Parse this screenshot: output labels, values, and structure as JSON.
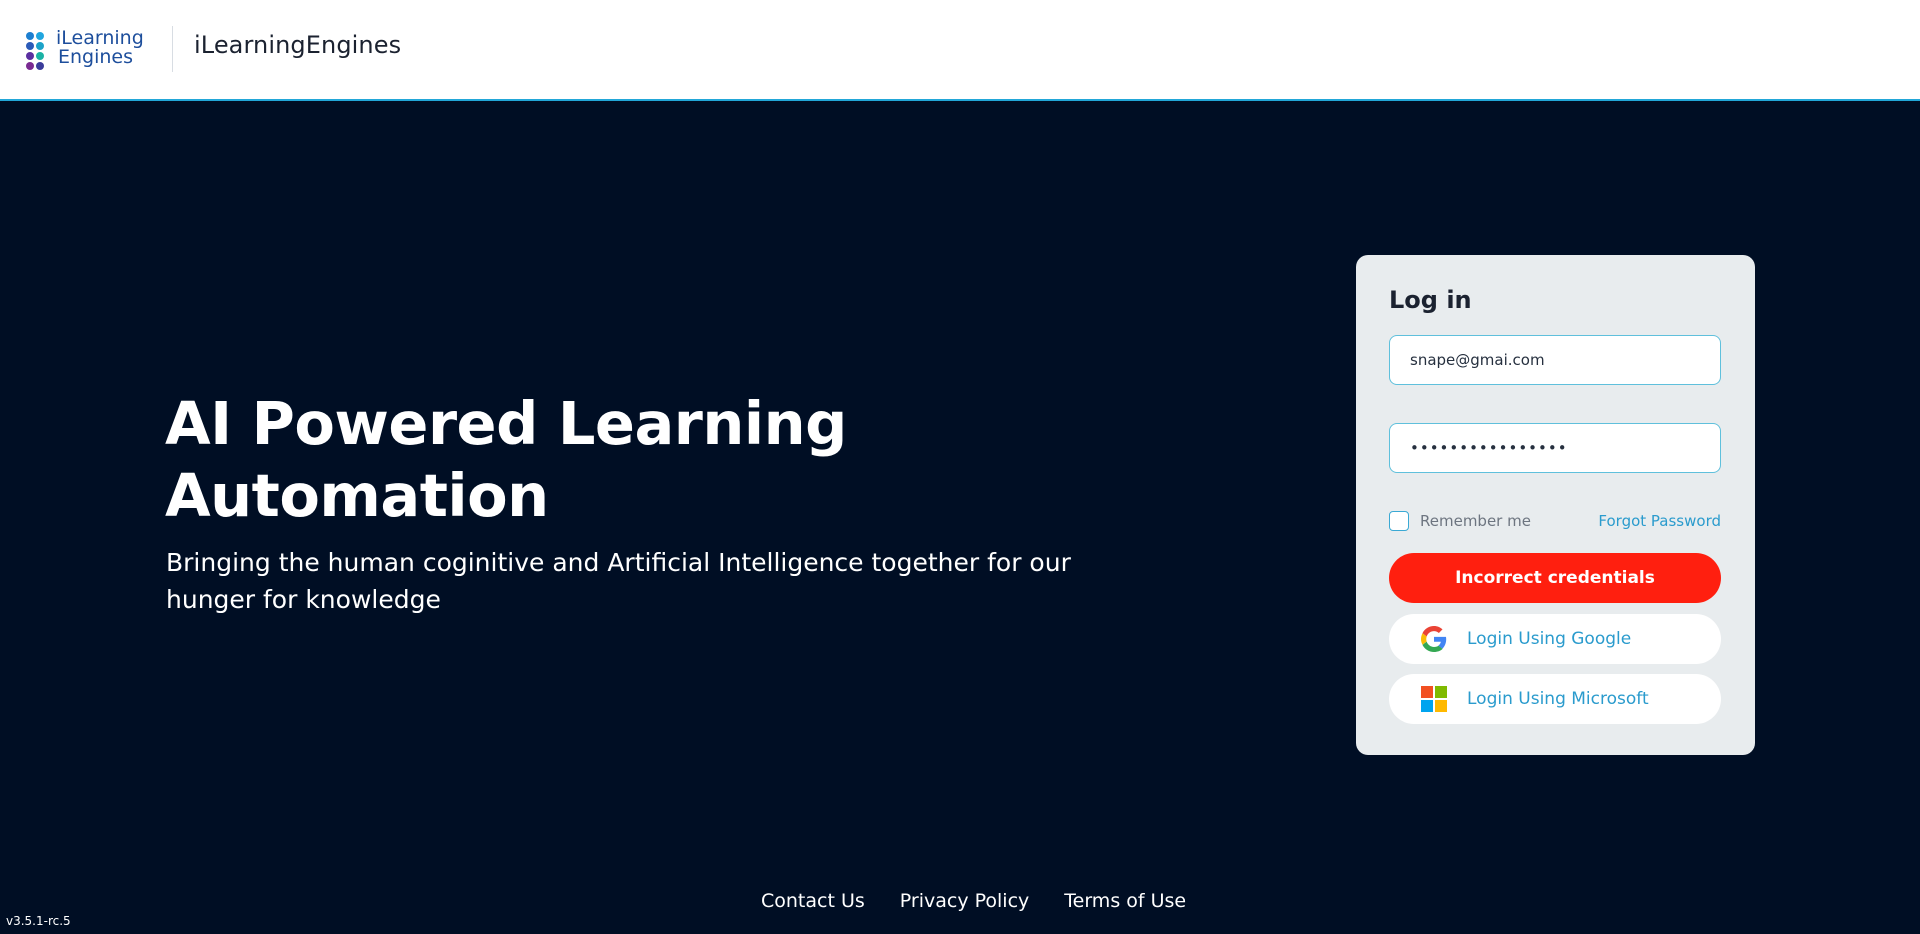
{
  "header": {
    "logo_line1": "iLearning",
    "logo_line2": "Engines",
    "brand_name": "iLearningEngines"
  },
  "hero": {
    "title_line1": "AI Powered Learning",
    "title_line2": "Automation",
    "subtitle": "Bringing the human coginitive and Artificial Intelligence together for our hunger for knowledge"
  },
  "login": {
    "title": "Log in",
    "email_value": "snape@gmai.com",
    "password_value": "••••••••••••••••",
    "remember_label": "Remember me",
    "remember_checked": false,
    "forgot_label": "Forgot Password",
    "error_button_label": "Incorrect credentials",
    "google_label": "Login Using Google",
    "microsoft_label": "Login Using Microsoft"
  },
  "footer": {
    "links": [
      "Contact Us",
      "Privacy Policy",
      "Terms of Use"
    ],
    "version": "v3.5.1-rc.5"
  },
  "colors": {
    "background": "#000e24",
    "accent": "#2a9bcd",
    "error": "#ff1f0f",
    "card": "#e8ecee"
  }
}
